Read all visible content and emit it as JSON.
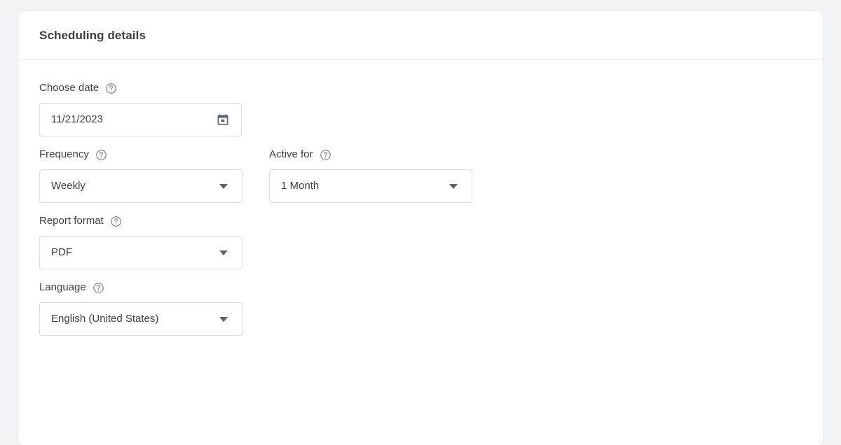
{
  "card": {
    "title": "Scheduling details"
  },
  "icons": {
    "help": "help-outline-icon",
    "calendar": "calendar-icon",
    "dropdown": "chevron-down-icon"
  },
  "fields": {
    "choose_date": {
      "label": "Choose date",
      "value": "11/21/2023",
      "type": "date-input"
    },
    "frequency": {
      "label": "Frequency",
      "value": "Weekly",
      "type": "select"
    },
    "active_for": {
      "label": "Active for",
      "value": "1 Month",
      "type": "select"
    },
    "report_format": {
      "label": "Report format",
      "value": "PDF",
      "type": "select"
    },
    "language": {
      "label": "Language",
      "value": "English (United States)",
      "type": "select"
    }
  },
  "colors": {
    "page_background": "#f1f3f4",
    "card_background": "#ffffff",
    "border": "#dadce0",
    "divider": "#e8eaed",
    "text_primary": "#3c4043",
    "icon": "#5f6368",
    "help_icon": "#80868b"
  }
}
